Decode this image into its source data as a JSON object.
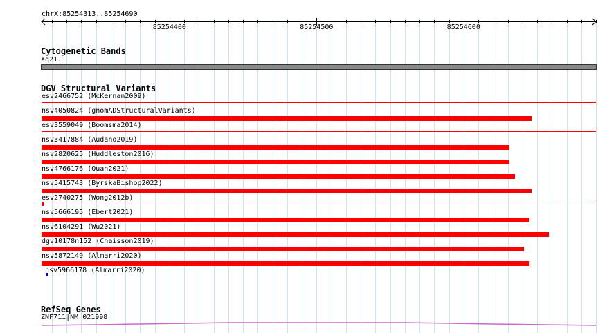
{
  "ruler": {
    "range_label": "chrX:85254313..85254690",
    "tick_labels": [
      "85254400",
      "85254500",
      "85254600"
    ]
  },
  "cytoband": {
    "title": "Cytogenetic Bands",
    "band_label": "Xq21.1"
  },
  "dgv": {
    "title": "DGV Structural Variants",
    "color": "#ff0000",
    "variants": [
      {
        "label": "esv2466752 (McKernan2009)",
        "start": 85254313,
        "end": 85254690,
        "kind": "line"
      },
      {
        "label": "nsv4050824 (gnomADStructuralVariants)",
        "start": 85254313,
        "end": 85254646,
        "kind": "bar"
      },
      {
        "label": "esv3559049 (Boomsma2014)",
        "start": 85254313,
        "end": 85254690,
        "kind": "line"
      },
      {
        "label": "nsv3417884 (Audano2019)",
        "start": 85254313,
        "end": 85254631,
        "kind": "bar"
      },
      {
        "label": "nsv2820625 (Huddleston2016)",
        "start": 85254313,
        "end": 85254631,
        "kind": "bar"
      },
      {
        "label": "nsv4766176 (Quan2021)",
        "start": 85254313,
        "end": 85254635,
        "kind": "bar"
      },
      {
        "label": "nsv5415743 (ByrskaBishop2022)",
        "start": 85254313,
        "end": 85254646,
        "kind": "bar"
      },
      {
        "label": "esv2740275 (Wong2012b)",
        "start": 85254313,
        "end": 85254690,
        "kind": "line"
      },
      {
        "label": "nsv5666195 (Ebert2021)",
        "start": 85254313,
        "end": 85254645,
        "kind": "bar"
      },
      {
        "label": "nsv6104291 (Wu2021)",
        "start": 85254313,
        "end": 85254658,
        "kind": "bar"
      },
      {
        "label": "dgv10178n152 (Chaisson2019)",
        "start": 85254313,
        "end": 85254641,
        "kind": "bar"
      },
      {
        "label": "nsv5872149 (Almarri2020)",
        "start": 85254313,
        "end": 85254645,
        "kind": "bar"
      },
      {
        "label": "nsv5966178 (Almarri2020)",
        "start": 85254316,
        "end": 85254317,
        "kind": "small",
        "color": "#0000cc"
      }
    ]
  },
  "refseq": {
    "title": "RefSeq Genes",
    "gene_label": "ZNF711|NM_021998",
    "color": "#cc66cc"
  }
}
